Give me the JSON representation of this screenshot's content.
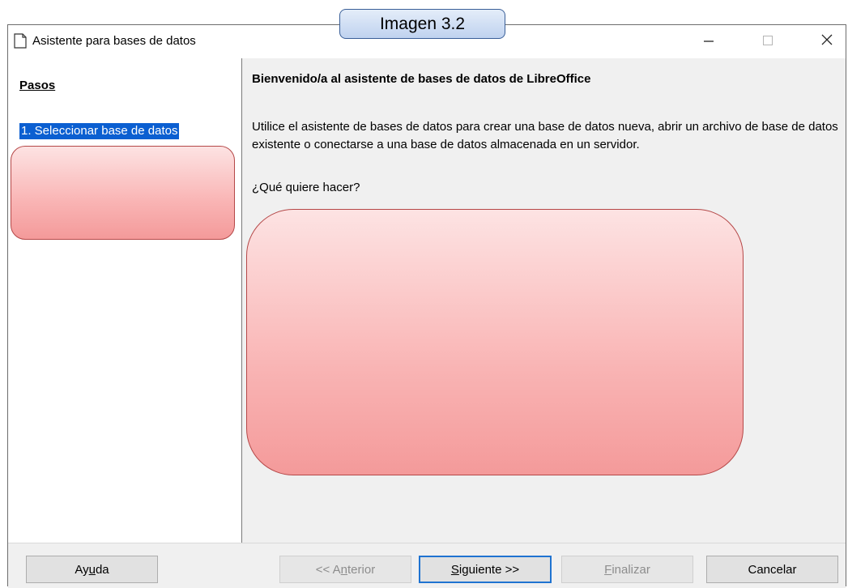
{
  "caption": "Imagen 3.2",
  "window": {
    "title": "Asistente para bases de datos",
    "minimize_glyph": "—",
    "maximize_glyph": "☐",
    "close_glyph": "✕"
  },
  "sidebar": {
    "title": "Pasos",
    "items": [
      {
        "label": "1. Seleccionar base de datos",
        "selected": true
      }
    ]
  },
  "main": {
    "heading": "Bienvenido/a al asistente de bases de datos de LibreOffice",
    "description": "Utilice el asistente de bases de datos para crear una base de datos nueva, abrir un archivo de base de datos existente o conectarse a una base de datos almacenada en un servidor.",
    "question": "¿Qué quiere hacer?"
  },
  "buttons": {
    "help": {
      "pre": "Ay",
      "accel": "u",
      "post": "da"
    },
    "previous": {
      "pre": "<< A",
      "accel": "n",
      "post": "terior"
    },
    "next": {
      "pre": "",
      "accel": "S",
      "post": "iguiente >>"
    },
    "finish": {
      "pre": "",
      "accel": "F",
      "post": "inalizar"
    },
    "cancel": {
      "pre": "Cancelar",
      "accel": "",
      "post": ""
    }
  },
  "colors": {
    "selection": "#0b5fd1",
    "redaction_fill": "#f9b4b4",
    "redaction_border": "#b54848",
    "caption_fill": "#bfd2ef",
    "default_button_border": "#1f73d1"
  },
  "icons": [
    "document-icon",
    "minimize-icon",
    "maximize-icon",
    "close-icon"
  ]
}
